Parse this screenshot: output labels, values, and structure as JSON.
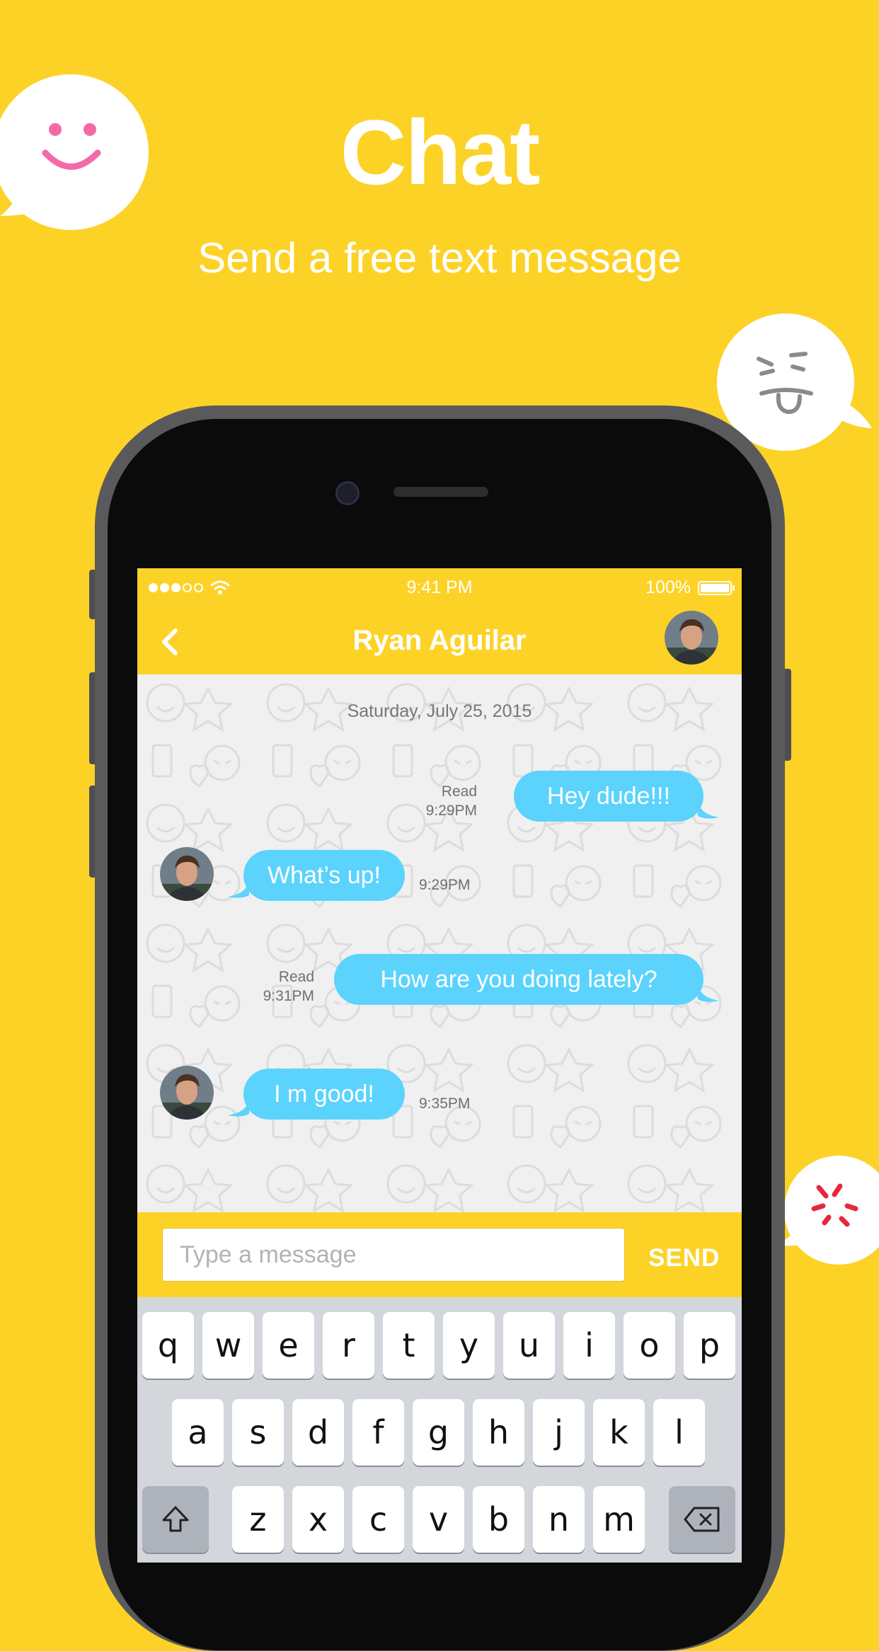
{
  "hero": {
    "title": "Chat",
    "subtitle": "Send a free text message"
  },
  "status_bar": {
    "time": "9:41 PM",
    "battery": "100%"
  },
  "chat_header": {
    "contact_name": "Ryan Aguilar"
  },
  "chat": {
    "date": "Saturday, July 25, 2015",
    "messages": [
      {
        "direction": "outgoing",
        "text": "Hey dude!!!",
        "status": "Read",
        "time": "9:29PM"
      },
      {
        "direction": "incoming",
        "text": "What’s up!",
        "time": "9:29PM"
      },
      {
        "direction": "outgoing",
        "text": "How are you doing lately?",
        "status": "Read",
        "time": "9:31PM"
      },
      {
        "direction": "incoming",
        "text": "I m good!",
        "time": "9:35PM"
      }
    ]
  },
  "composer": {
    "placeholder": "Type a message",
    "send_label": "SEND"
  },
  "keyboard": {
    "row1": [
      "q",
      "w",
      "e",
      "r",
      "t",
      "y",
      "u",
      "i",
      "o",
      "p"
    ],
    "row2": [
      "a",
      "s",
      "d",
      "f",
      "g",
      "h",
      "j",
      "k",
      "l"
    ],
    "row3": [
      "z",
      "x",
      "c",
      "v",
      "b",
      "n",
      "m"
    ]
  },
  "colors": {
    "background": "#fdd226",
    "bubble": "#5bd3fd",
    "header": "#fdd226",
    "smiley_pink": "#f36aa8",
    "angry_red": "#e8283a"
  }
}
